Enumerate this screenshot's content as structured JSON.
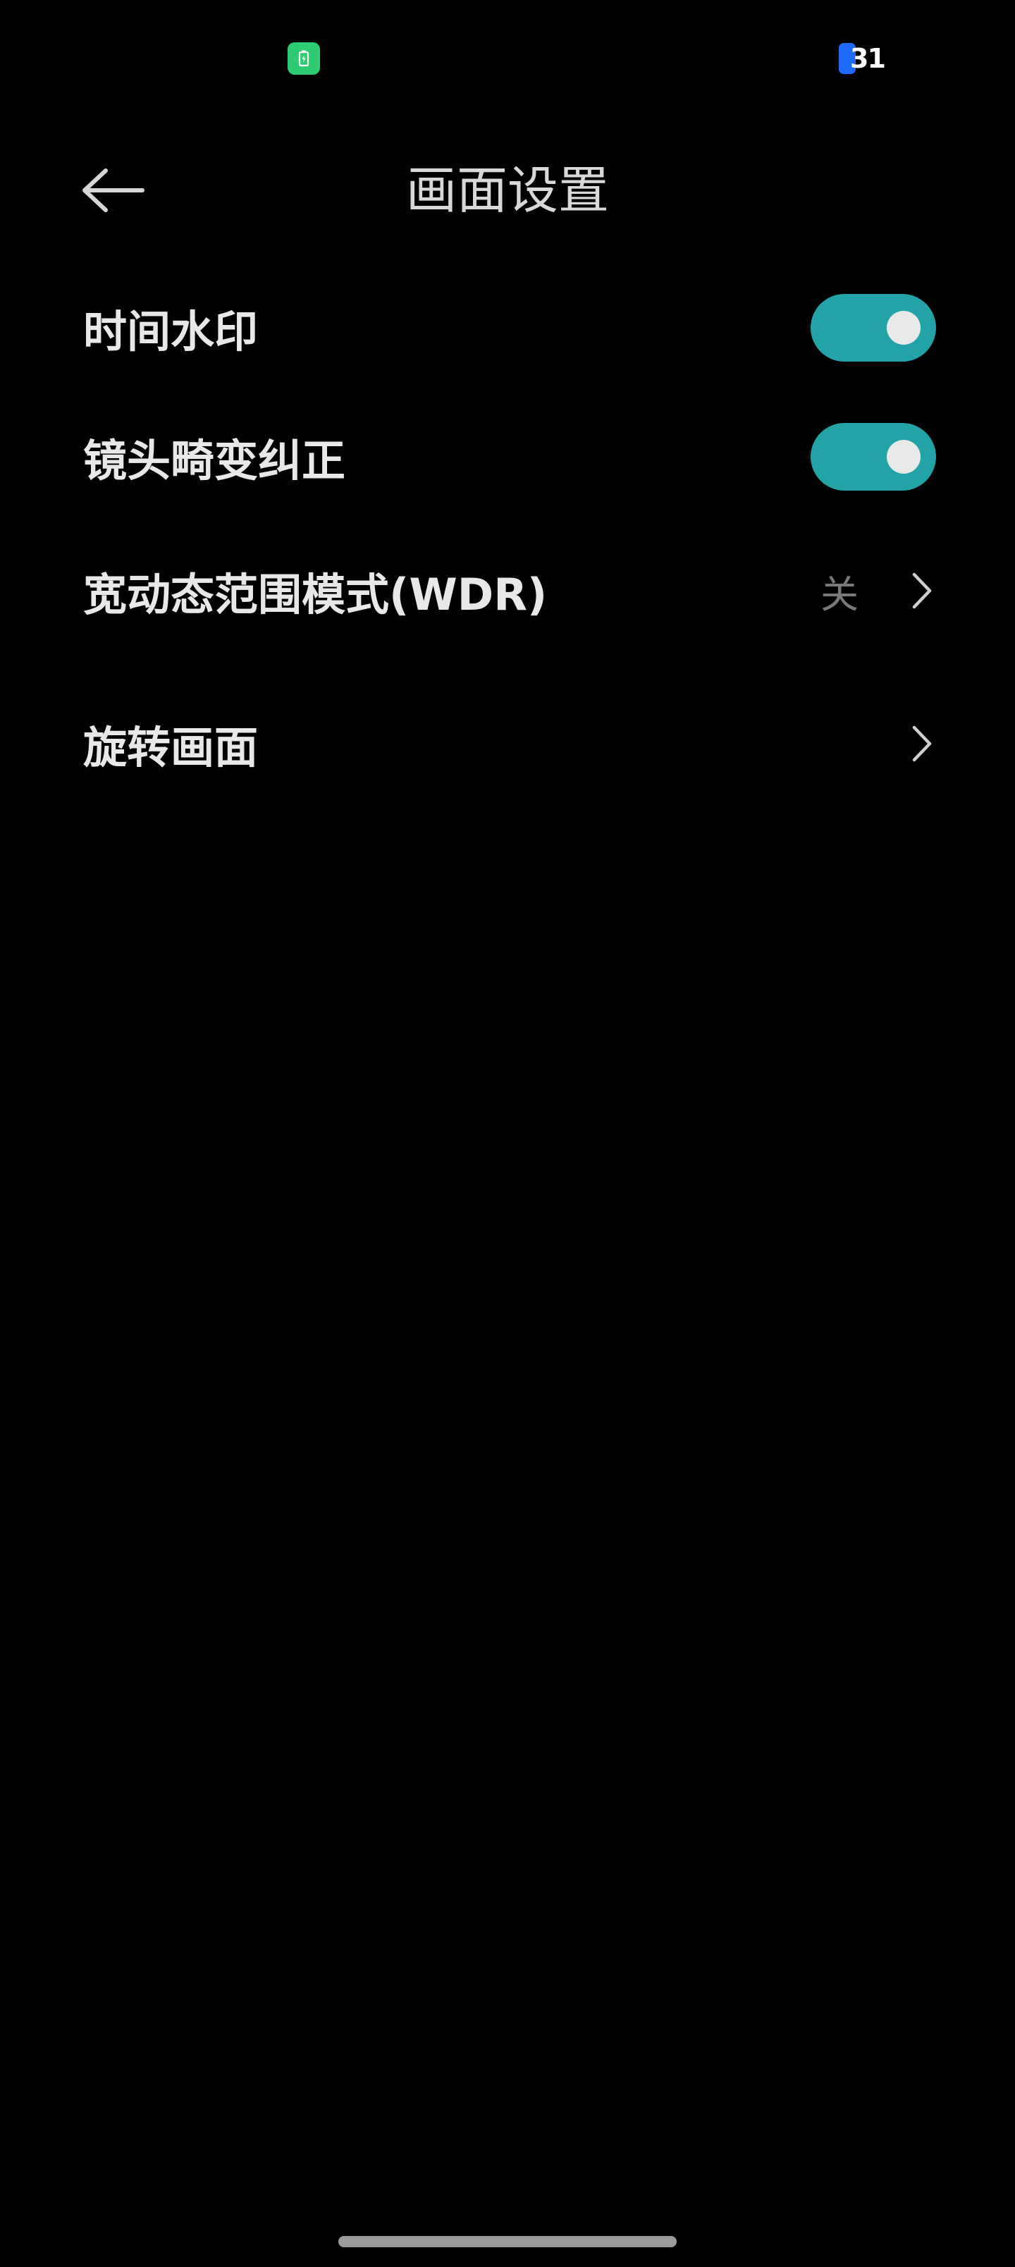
{
  "status_bar": {
    "battery_icon": "battery-charging-icon",
    "badge_number": "31",
    "colors": {
      "battery": "#2ecc71",
      "badge": "#1e6bff"
    }
  },
  "header": {
    "back_icon": "back-arrow-icon",
    "title": "画面设置"
  },
  "settings": {
    "time_watermark": {
      "label": "时间水印",
      "enabled": true
    },
    "lens_distortion": {
      "label": "镜头畸变纠正",
      "enabled": true
    },
    "wdr": {
      "label": "宽动态范围模式(WDR)",
      "value": "关"
    },
    "rotate": {
      "label": "旋转画面"
    }
  },
  "colors": {
    "background": "#000000",
    "toggle_on": "#21a3a7",
    "text": "#e8e8e8",
    "secondary_text": "#7a7a7a"
  }
}
